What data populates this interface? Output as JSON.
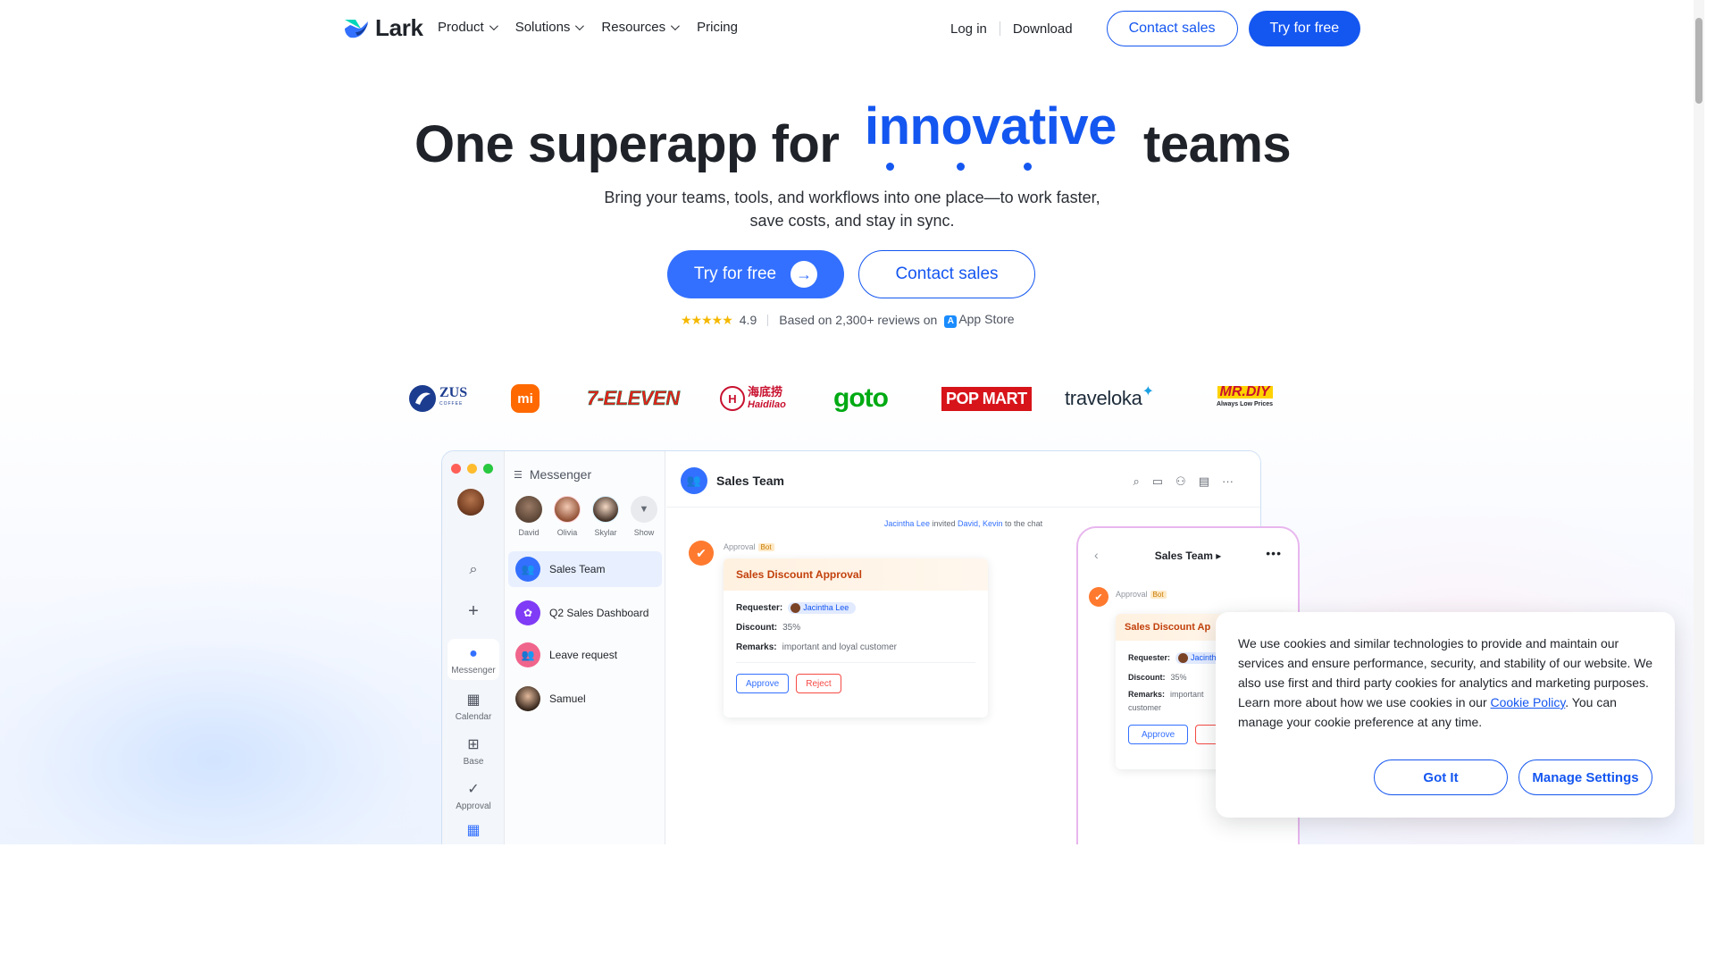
{
  "nav": {
    "brand": "Lark",
    "links": [
      {
        "label": "Product",
        "has_dropdown": true
      },
      {
        "label": "Solutions",
        "has_dropdown": true
      },
      {
        "label": "Resources",
        "has_dropdown": true
      },
      {
        "label": "Pricing",
        "has_dropdown": false
      }
    ],
    "login": "Log in",
    "download": "Download",
    "contact_sales": "Contact sales",
    "try_free": "Try for free"
  },
  "hero": {
    "title_before": "One superapp for",
    "title_rotating_word": "innovative",
    "title_after": "teams",
    "subtitle_line1": "Bring your teams, tools, and workflows into one place—to work faster,",
    "subtitle_line2": "save costs, and stay in sync.",
    "cta_primary": "Try for free",
    "cta_secondary": "Contact sales",
    "rating_value": "4.9",
    "rating_text": "Based on 2,300+ reviews on",
    "rating_store": "App Store",
    "stars": "★★★★★"
  },
  "customer_logos": [
    "ZUS",
    "mi",
    "7-ELEVEN",
    "Haidilao",
    "goto",
    "POP MART",
    "traveloka",
    "MR.DIY"
  ],
  "logo_subtext": {
    "haidilao_cn": "海底捞",
    "mrdiy_tagline": "Always Low Prices",
    "zus_sub": "COFFEE"
  },
  "mockup": {
    "rail": [
      {
        "label": "Messenger",
        "icon": "chat-bubble-icon"
      },
      {
        "label": "Calendar",
        "icon": "calendar-icon"
      },
      {
        "label": "Base",
        "icon": "base-icon"
      },
      {
        "label": "Approval",
        "icon": "approval-icon"
      }
    ],
    "list_title": "Messenger",
    "contacts": [
      "David",
      "Olivia",
      "Skylar",
      "Show"
    ],
    "chats": [
      "Sales Team",
      "Q2 Sales Dashboard",
      "Leave request",
      "Samuel"
    ],
    "chat_title": "Sales Team",
    "system_message": {
      "inviter": "Jacintha Lee",
      "verb": "invited",
      "invitees": "David, Kevin",
      "suffix": "to the chat"
    },
    "bot_name": "Approval",
    "bot_tag": "Bot",
    "card": {
      "title": "Sales Discount Approval",
      "requester_label": "Requester:",
      "requester": "Jacintha Lee",
      "discount_label": "Discount:",
      "discount": "35%",
      "remarks_label": "Remarks:",
      "remarks": "important and loyal customer",
      "approve": "Approve",
      "reject": "Reject"
    },
    "phone": {
      "title": "Sales Team ▸",
      "card_title": "Sales Discount Ap",
      "requester_chip": "Jacinth",
      "remarks_line1": "important",
      "remarks_line2": "customer"
    }
  },
  "cookie": {
    "text": "We use cookies and similar technologies to provide and maintain our services and ensure performance, security, and stability of our website. We also use first and third party cookies for analytics and marketing purposes. Learn more about how we use cookies in our",
    "link": "Cookie Policy",
    "text_after": ". You can manage your cookie preference at any time.",
    "got_it": "Got It",
    "manage": "Manage Settings"
  },
  "colors": {
    "brand_blue": "#1456f0",
    "cta_blue": "#3370ff",
    "approval_orange": "#ff7a2f",
    "reject_red": "#f54a45"
  }
}
